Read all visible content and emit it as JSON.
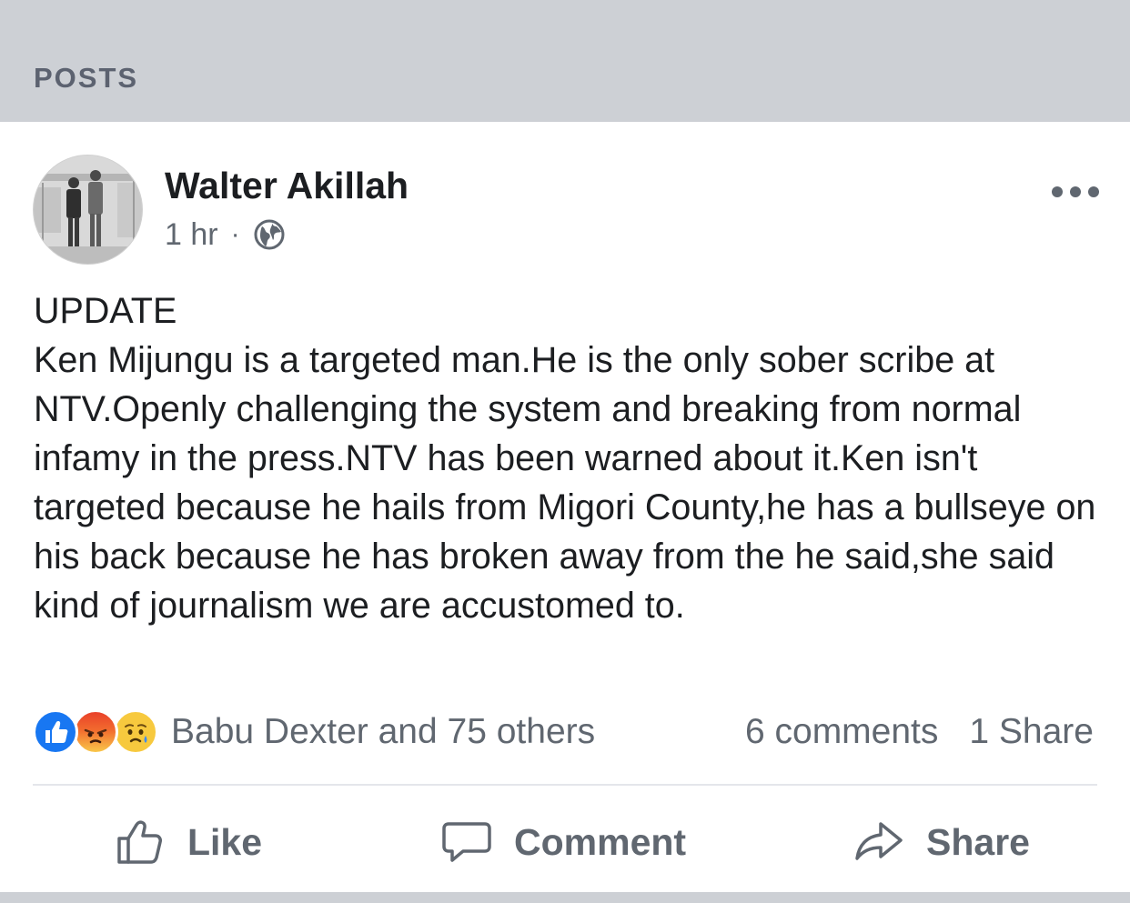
{
  "section": {
    "title": "POSTS"
  },
  "post": {
    "author": "Walter Akillah",
    "time": "1 hr",
    "separator": "·",
    "privacy_icon": "globe-icon",
    "menu_icon": "more-options-icon",
    "text": "UPDATE\nKen Mijungu is a targeted man.He is the only sober scribe at NTV.Openly challenging the system and breaking  from normal infamy in the press.NTV has been warned about it.Ken isn't targeted because he hails from Migori County,he has a bullseye on his back because he has broken away from the he said,she said kind of journalism we are accustomed to.",
    "reactions": {
      "icons": [
        "like-reaction-icon",
        "angry-reaction-icon",
        "sad-reaction-icon"
      ],
      "names": "Babu Dexter and 75 others"
    },
    "comments_count": "6 comments",
    "shares_count": "1 Share"
  },
  "actions": {
    "like_label": "Like",
    "comment_label": "Comment",
    "share_label": "Share"
  },
  "colors": {
    "header_bg": "#cdd0d5",
    "muted_text": "#606770",
    "like_blue": "#1877f2"
  }
}
